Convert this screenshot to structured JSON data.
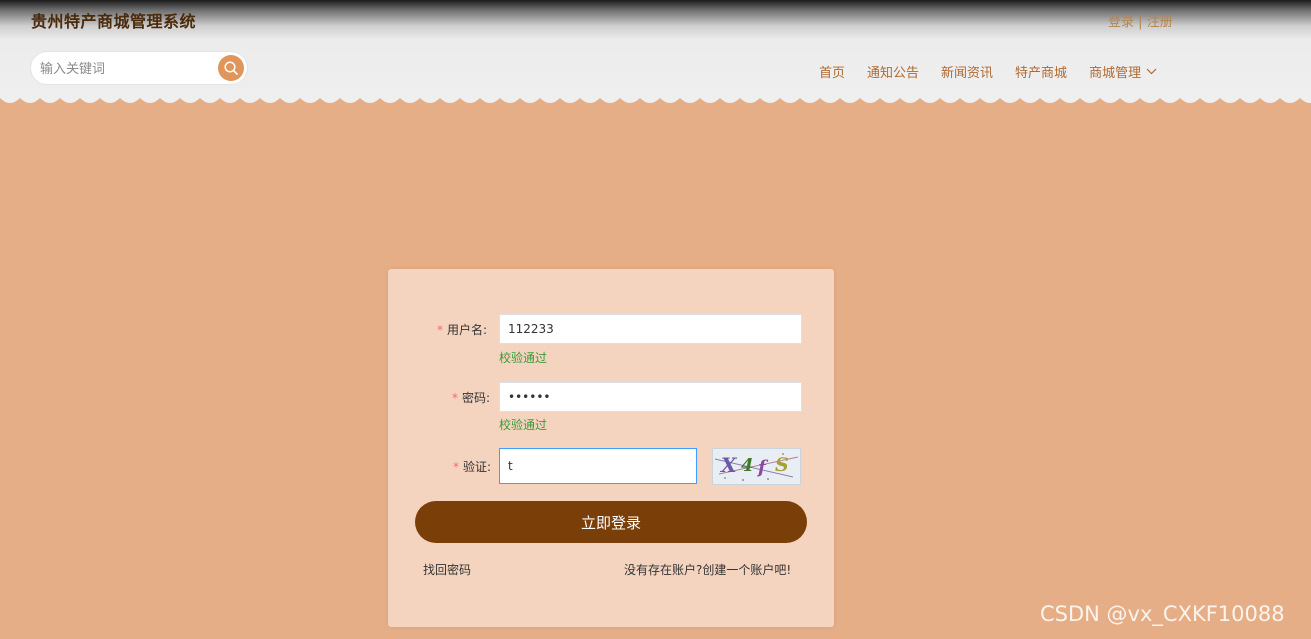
{
  "header": {
    "site_title": "贵州特产商城管理系统",
    "auth": {
      "login": "登录",
      "separator": "|",
      "register": "注册"
    },
    "search": {
      "placeholder": "输入关键词"
    },
    "nav": [
      {
        "label": "首页"
      },
      {
        "label": "通知公告"
      },
      {
        "label": "新闻资讯"
      },
      {
        "label": "特产商城"
      },
      {
        "label": "商城管理"
      }
    ]
  },
  "login_form": {
    "username": {
      "label": "用户名:",
      "value": "112233",
      "hint": "校验通过"
    },
    "password": {
      "label": "密码:",
      "value": "••••••",
      "hint": "校验通过"
    },
    "captcha": {
      "label": "验证:",
      "value": "t",
      "image_text": "X4fS"
    },
    "submit_label": "立即登录",
    "forgot_password": "找回密码",
    "register_prompt": "没有存在账户?创建一个账户吧!"
  },
  "watermark": "CSDN @vx_CXKF10088",
  "colors": {
    "background": "#e6ae87",
    "card": "#f4d4bf",
    "button": "#7a3e08",
    "nav_text": "#b06a30",
    "success": "#3c9a3c",
    "required": "#f56c6c"
  }
}
